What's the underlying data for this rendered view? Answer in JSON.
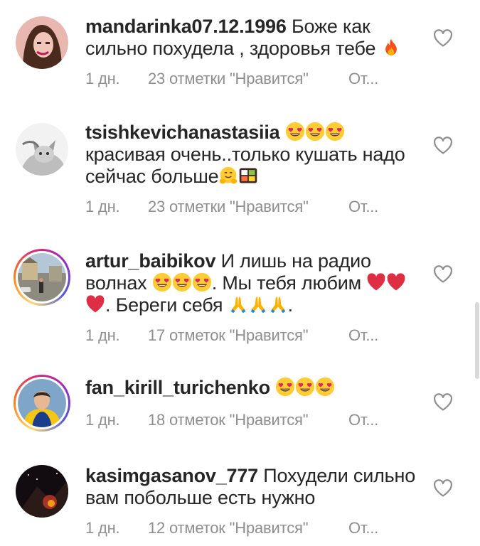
{
  "comments": [
    {
      "username": "mandarinka07.12.1996",
      "text_before": " Боже как сильно похудела , здоровья тебе ",
      "emojis": [
        "fire-emoji"
      ],
      "text_after": "",
      "age": "1 дн.",
      "likes": "23 отметки \"Нравится\"",
      "reply": "От..."
    },
    {
      "username": "tsishkevichanastasiia",
      "text_before": " ",
      "emojis": [
        "heart-eyes-emoji",
        "heart-eyes-emoji",
        "heart-eyes-emoji"
      ],
      "text_after": "",
      "text_line2": "красивая очень..только кушать надо сейчас больше",
      "emojis2": [
        "hugging-emoji",
        "bento-emoji"
      ],
      "age": "1 дн.",
      "likes": "23 отметки \"Нравится\"",
      "reply": "От..."
    },
    {
      "username": "artur_baibikov",
      "text_before": " И лишь на радио волнах ",
      "emojis": [
        "heart-eyes-emoji",
        "heart-eyes-emoji",
        "heart-eyes-emoji"
      ],
      "text_mid": ". Мы тебя любим ",
      "emojis_mid": [
        "red-heart-emoji",
        "red-heart-emoji",
        "red-heart-emoji"
      ],
      "text_mid2": ". Береги себя ",
      "emojis_end": [
        "pray-emoji",
        "pray-emoji",
        "pray-emoji"
      ],
      "text_after": ".",
      "age": "1 дн.",
      "likes": "17 отметок \"Нравится\"",
      "reply": "От..."
    },
    {
      "username": "fan_kirill_turichenko",
      "text_before": " ",
      "emojis": [
        "heart-eyes-emoji",
        "heart-eyes-emoji",
        "heart-eyes-emoji"
      ],
      "text_after": "",
      "age": "1 дн.",
      "likes": "18 отметок \"Нравится\"",
      "reply": "От..."
    },
    {
      "username": "kasimgasanov_777",
      "text_before": " Похудели сильно вам побольше есть нужно",
      "emojis": [],
      "text_after": "",
      "age": "1 дн.",
      "likes": "12 отметок \"Нравится\"",
      "reply": "От..."
    }
  ],
  "colors": {
    "text": "#262626",
    "meta": "#8e8e8e",
    "heart_outline": "#8e8e8e",
    "emoji_red": "#e0245e"
  }
}
